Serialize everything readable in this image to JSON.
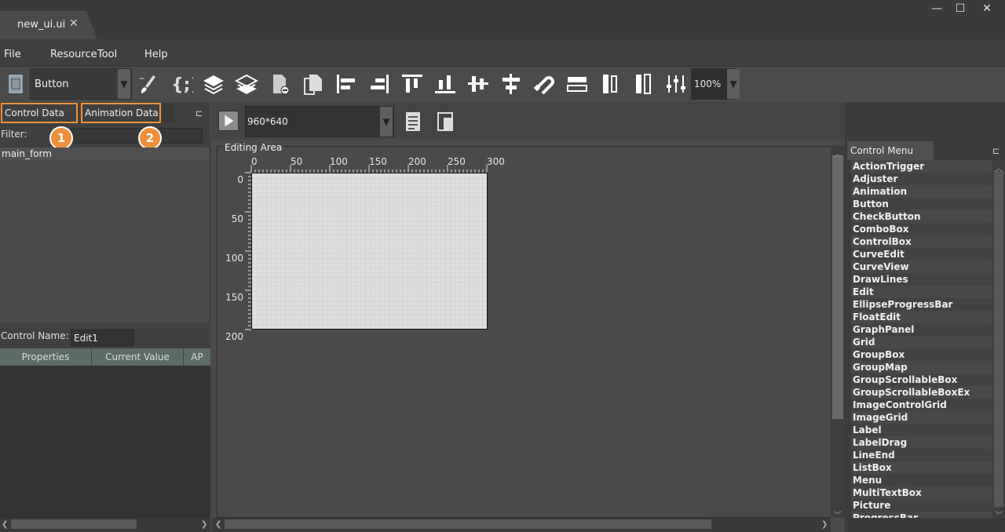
{
  "window": {
    "tab_title": "new_ui.ui",
    "tab_close": "✕",
    "minimize": "—",
    "maximize": "☐",
    "close": "✕"
  },
  "menu": {
    "file": "File",
    "resource": "Resource",
    "tool": "Tool",
    "help": "Help"
  },
  "toolbar": {
    "control_type": "Button",
    "zoom": "100%",
    "dropdown_arrow": "▼",
    "icons": [
      "form-icon",
      "brush-icon",
      "script-braces-icon",
      "layer-up-icon",
      "layer-down-icon",
      "delete-doc-icon",
      "copy-doc-icon",
      "align-left-icon",
      "align-right-icon",
      "align-top-icon",
      "align-bottom-icon",
      "align-hcenter-icon",
      "align-vcenter-icon",
      "magnet-icon",
      "same-width-icon",
      "same-height-icon",
      "same-size-icon",
      "properties-sliders-icon"
    ]
  },
  "left_panel": {
    "tab_control_data": "Control Data",
    "tab_animation_data": "Animation Data",
    "badge_1": "1",
    "badge_2": "2",
    "pin": "⊏",
    "filter_label": "Filter:",
    "filter_value": "",
    "tree_root": "main_form",
    "control_name_label": "Control Name:",
    "control_name_value": "Edit1",
    "columns": [
      "Properties",
      "Current Value",
      "AP"
    ]
  },
  "center": {
    "resolution": "960*640",
    "editing_area_label": "Editing Area",
    "ruler_x": [
      "0",
      "50",
      "100",
      "150",
      "200",
      "250",
      "300"
    ],
    "ruler_y": [
      "0",
      "50",
      "100",
      "150",
      "200"
    ]
  },
  "right_panel": {
    "title": "Control Menu",
    "pin": "⊏",
    "items": [
      "ActionTrigger",
      "Adjuster",
      "Animation",
      "Button",
      "CheckButton",
      "ComboBox",
      "ControlBox",
      "CurveEdit",
      "CurveView",
      "DrawLines",
      "Edit",
      "EllipseProgressBar",
      "FloatEdit",
      "GraphPanel",
      "Grid",
      "GroupBox",
      "GroupMap",
      "GroupScrollableBox",
      "GroupScrollableBoxEx",
      "ImageControlGrid",
      "ImageGrid",
      "Label",
      "LabelDrag",
      "LineEnd",
      "ListBox",
      "Menu",
      "MultiTextBox",
      "Picture",
      "ProgressBar"
    ]
  },
  "colors": {
    "highlight_orange": "#ee8f3b",
    "panel_bg": "#404040",
    "header_green": "#5c6b63"
  }
}
